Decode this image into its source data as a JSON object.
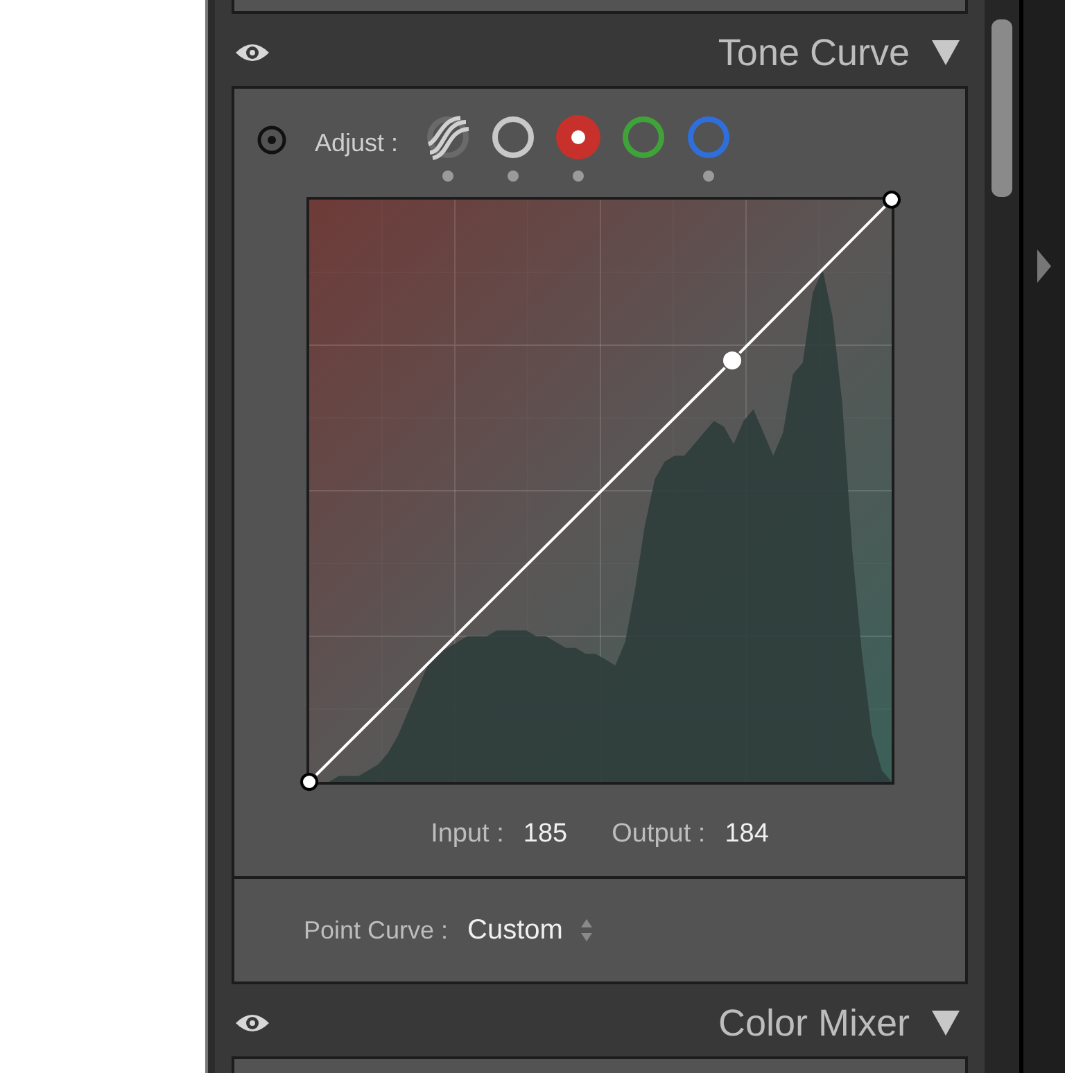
{
  "panels": [
    {
      "title": "Tone Curve",
      "expanded": true
    },
    {
      "title": "Color Mixer",
      "expanded": true
    }
  ],
  "adjust": {
    "label": "Adjust :",
    "channels": [
      {
        "kind": "parametric",
        "selected": false,
        "modified": true
      },
      {
        "kind": "point",
        "color": "#c8c8c8",
        "selected": false,
        "modified": true
      },
      {
        "kind": "point",
        "color": "#c8302c",
        "selected": true,
        "modified": true
      },
      {
        "kind": "point",
        "color": "#3fa33a",
        "selected": false,
        "modified": false
      },
      {
        "kind": "point",
        "color": "#2f6fdb",
        "selected": false,
        "modified": true
      }
    ]
  },
  "readout": {
    "input_label": "Input :",
    "input_value": "185",
    "output_label": "Output :",
    "output_value": "184"
  },
  "point_curve": {
    "label": "Point Curve :",
    "value": "Custom"
  }
}
